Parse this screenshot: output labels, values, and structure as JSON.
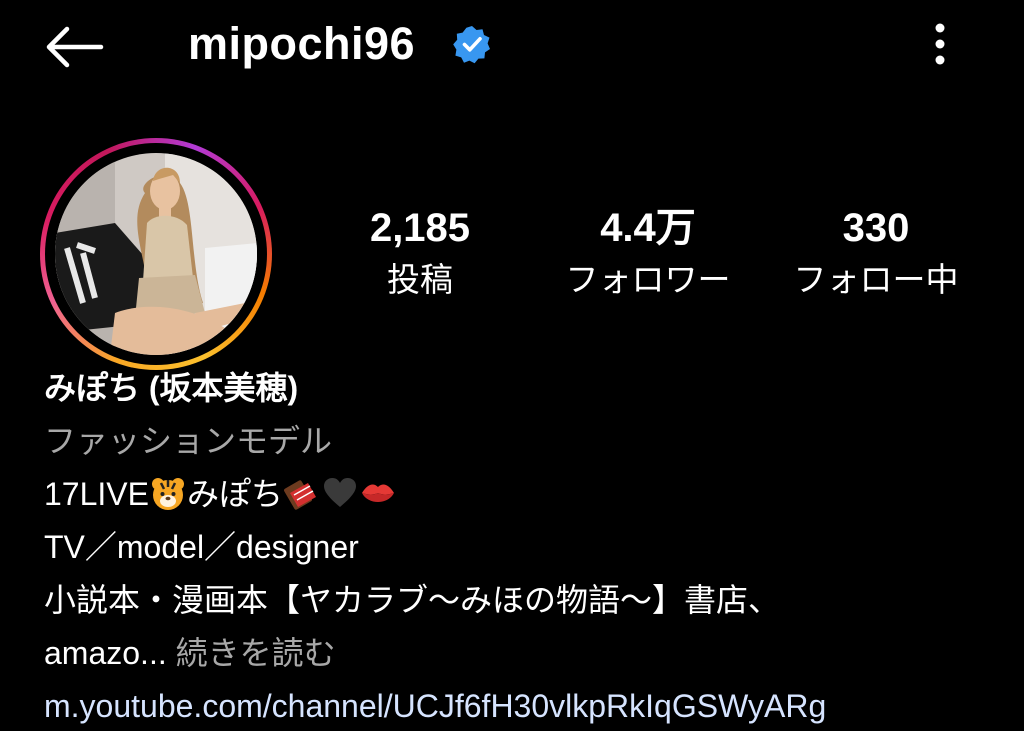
{
  "header": {
    "username": "mipochi96",
    "back_icon": "arrow-left-icon",
    "verified_icon": "verified-badge-icon",
    "more_icon": "more-vertical-icon"
  },
  "stats": [
    {
      "value": "2,185",
      "label": "投稿"
    },
    {
      "value": "4.4万",
      "label": "フォロワー"
    },
    {
      "value": "330",
      "label": "フォロー中"
    }
  ],
  "bio": {
    "display_name": "みぽち (坂本美穂)",
    "category": "ファッションモデル",
    "line1_text_a": "17LIVE",
    "line1_text_b": "みぽち",
    "line1_emojis": [
      "tiger-face-emoji",
      "chocolate-bar-emoji",
      "black-heart-emoji",
      "kiss-mark-emoji"
    ],
    "line2": "TV／model／designer",
    "line3": "小説本・漫画本【ヤカラブ〜みほの物語〜】書店、",
    "line4_text": "amazo...",
    "more_label": "続きを読む",
    "link": "m.youtube.com/channel/UCJf6fH30vlkpRkIqGSWyARg"
  },
  "colors": {
    "background": "#000000",
    "text": "#ffffff",
    "muted": "#a8a8a8",
    "link": "#d6e4ff",
    "verified": "#3897f0"
  }
}
